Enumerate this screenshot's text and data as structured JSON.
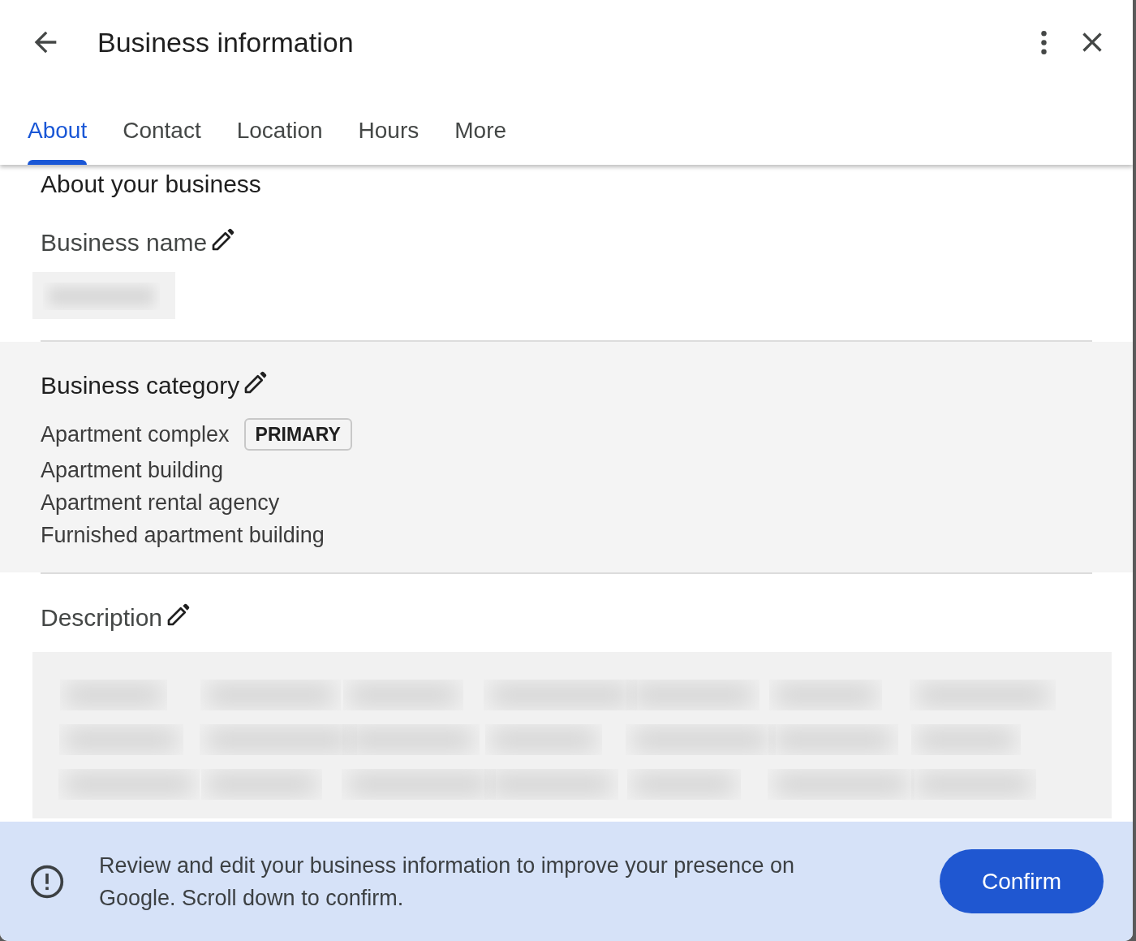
{
  "dialog": {
    "title": "Business information"
  },
  "tabs": [
    {
      "label": "About",
      "selected": true
    },
    {
      "label": "Contact",
      "selected": false
    },
    {
      "label": "Location",
      "selected": false
    },
    {
      "label": "Hours",
      "selected": false
    },
    {
      "label": "More",
      "selected": false
    }
  ],
  "section_heading": "About your business",
  "fields": [
    {
      "label": "Business name",
      "kind": "redacted-line",
      "highlighted": false
    },
    {
      "label": "Business category",
      "kind": "list",
      "highlighted": true,
      "items": [
        {
          "text": "Apartment complex",
          "badge": "PRIMARY"
        },
        {
          "text": "Apartment building"
        },
        {
          "text": "Apartment rental agency"
        },
        {
          "text": "Furnished apartment building"
        }
      ]
    },
    {
      "label": "Description",
      "kind": "redacted-block",
      "highlighted": false
    }
  ],
  "banner": {
    "message": "Review and edit your business information to improve your presence on Google. Scroll down to confirm.",
    "button": "Confirm"
  }
}
